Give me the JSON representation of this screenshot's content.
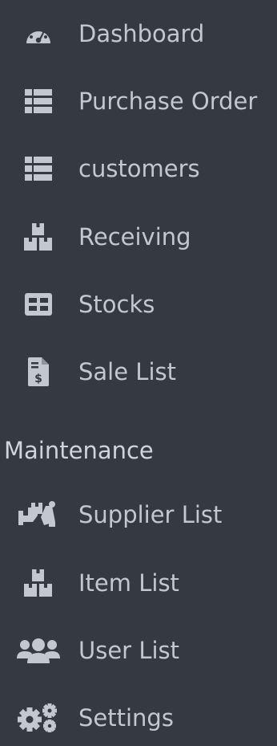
{
  "sidebar": {
    "items": [
      {
        "label": "Dashboard",
        "icon": "tachometer-icon"
      },
      {
        "label": "Purchase Order",
        "icon": "list-icon"
      },
      {
        "label": "customers",
        "icon": "list-icon"
      },
      {
        "label": "Receiving",
        "icon": "boxes-icon"
      },
      {
        "label": "Stocks",
        "icon": "table-icon"
      },
      {
        "label": "Sale List",
        "icon": "invoice-dollar-icon"
      }
    ],
    "maintenance_header": "Maintenance",
    "maintenance_items": [
      {
        "label": "Supplier List",
        "icon": "people-carry-icon"
      },
      {
        "label": "Item List",
        "icon": "boxes-icon"
      },
      {
        "label": "User List",
        "icon": "users-icon"
      },
      {
        "label": "Settings",
        "icon": "cogs-icon"
      }
    ]
  },
  "colors": {
    "background": "#343a40",
    "text": "#c2c7d0",
    "icon": "#c2c7d0"
  }
}
